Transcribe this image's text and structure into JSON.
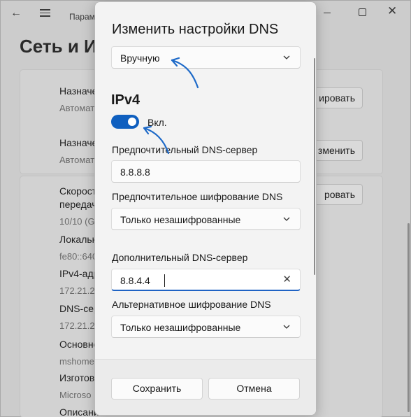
{
  "background": {
    "app_title": "Парам",
    "heading": "Сеть и И",
    "rows": [
      {
        "label": "Назначе",
        "value": "Автомат",
        "button": "ировать"
      },
      {
        "label": "Назначе",
        "value": "Автомат",
        "button": "зменить"
      },
      {
        "label": "Скорост",
        "label2": "передач",
        "value": "10/10 (Gl",
        "button": "ровать"
      },
      {
        "label": "Локальн",
        "value": "fe80::640"
      },
      {
        "label": "IPv4-адр",
        "value": "172.21.22"
      },
      {
        "label": "DNS-сер",
        "value": "172.21.22"
      },
      {
        "label": "Основно",
        "value": "mshome"
      },
      {
        "label": "Изготов",
        "value": "Microso"
      },
      {
        "label": "Описани"
      }
    ]
  },
  "dialog": {
    "title": "Изменить настройки DNS",
    "mode_value": "Вручную",
    "section": "IPv4",
    "toggle_label": "Вкл.",
    "toggle_on": true,
    "preferred_dns_label": "Предпочтительный DNS-сервер",
    "preferred_dns_value": "8.8.8.8",
    "preferred_enc_label": "Предпочтительное шифрование DNS",
    "preferred_enc_value": "Только незашифрованные",
    "alternate_dns_label": "Дополнительный DNS-сервер",
    "alternate_dns_value": "8.8.4.4",
    "alternate_enc_label": "Альтернативное шифрование DNS",
    "alternate_enc_value": "Только незашифрованные",
    "save_label": "Сохранить",
    "cancel_label": "Отмена"
  },
  "colors": {
    "accent": "#0f5fbf",
    "annotation_arrow": "#1e6ac8"
  },
  "icons": [
    "back-arrow-icon",
    "hamburger-menu-icon",
    "minimize-icon",
    "maximize-icon",
    "close-icon",
    "chevron-down-icon",
    "clear-x-icon"
  ]
}
